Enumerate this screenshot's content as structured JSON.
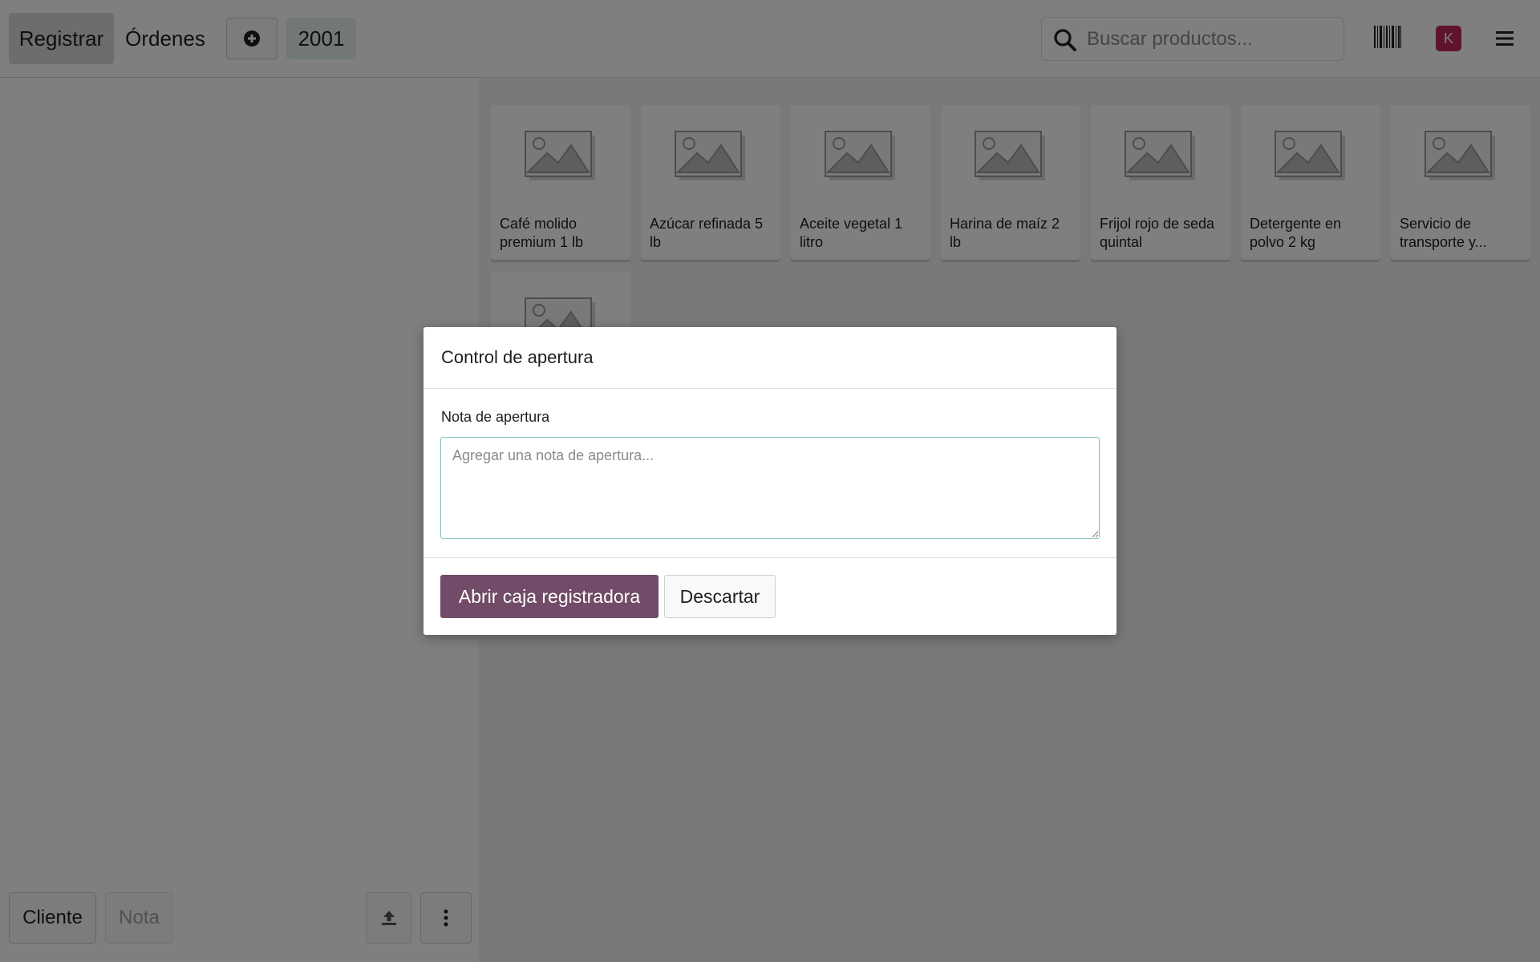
{
  "header": {
    "nav": {
      "register_label": "Registrar",
      "orders_label": "Órdenes",
      "order_number": "2001"
    },
    "search": {
      "placeholder": "Buscar productos..."
    },
    "avatar_initial": "K",
    "icons": {
      "add": "plus-circle-icon",
      "search": "search-icon",
      "barcode": "barcode-icon",
      "menu": "hamburger-menu-icon"
    }
  },
  "left_panel": {
    "buttons": {
      "customer_label": "Cliente",
      "note_label": "Nota"
    },
    "icons": {
      "upload": "upload-icon",
      "more": "more-vertical-icon"
    }
  },
  "products": [
    {
      "name": "Café molido premium 1 lb"
    },
    {
      "name": "Azúcar refinada 5 lb"
    },
    {
      "name": "Aceite vegetal 1 litro"
    },
    {
      "name": "Harina de maíz 2 lb"
    },
    {
      "name": "Frijol rojo de seda quintal"
    },
    {
      "name": "Detergente en polvo 2 kg"
    },
    {
      "name": "Servicio de transporte y..."
    },
    {
      "name": ""
    }
  ],
  "modal": {
    "title": "Control de apertura",
    "note_label": "Nota de apertura",
    "note_placeholder": "Agregar una nota de apertura...",
    "note_value": "",
    "primary_label": "Abrir caja registradora",
    "secondary_label": "Descartar"
  },
  "colors": {
    "primary": "#714b67",
    "avatar": "#c0265a",
    "textarea_focus": "#7fbfbf"
  }
}
